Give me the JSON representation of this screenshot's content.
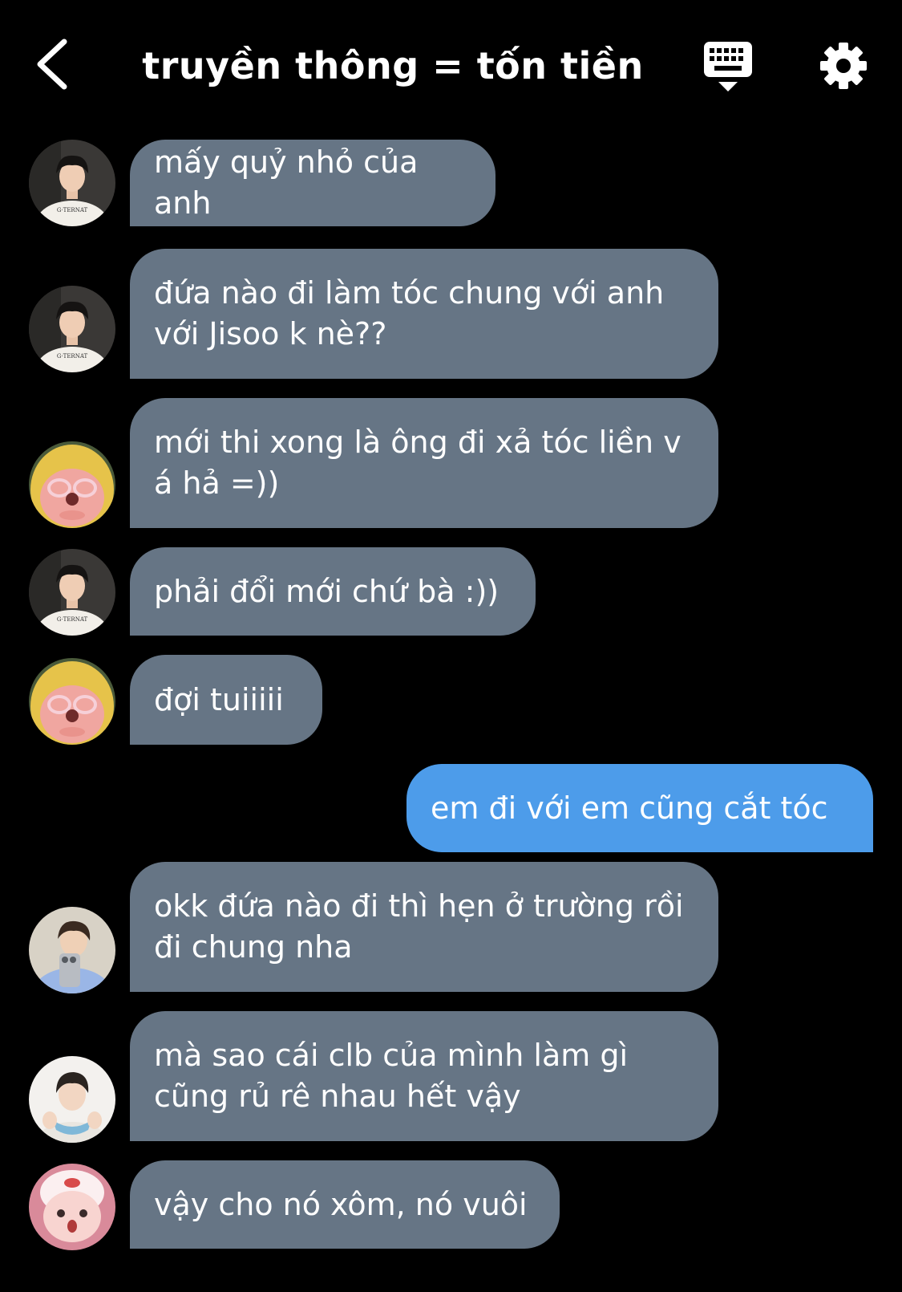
{
  "header": {
    "title": "truyền thông = tốn tiền",
    "back_icon": "chevron-left-icon",
    "keyboard_icon": "keyboard-icon",
    "settings_icon": "gear-icon"
  },
  "colors": {
    "background": "#000000",
    "incoming_bubble": "#667585",
    "outgoing_bubble": "#4d9cea",
    "text": "#ffffff"
  },
  "messages": [
    {
      "text": "mấy quỷ nhỏ của anh",
      "direction": "incoming",
      "avatar": "boy-black-hair-white-shirt"
    },
    {
      "text": "đứa nào đi làm tóc chung với anh với Jisoo k nè??",
      "direction": "incoming",
      "avatar": "boy-black-hair-white-shirt"
    },
    {
      "text": "mới thi xong là ông đi xả tóc liền v á hả =))",
      "direction": "incoming",
      "avatar": "pink-plush-yellow-hat"
    },
    {
      "text": "phải đổi mới chứ bà :))",
      "direction": "incoming",
      "avatar": "boy-black-hair-white-shirt"
    },
    {
      "text": "đợi tuiiiii",
      "direction": "incoming",
      "avatar": "pink-plush-yellow-hat"
    },
    {
      "text": "em đi với em cũng cắt tóc",
      "direction": "outgoing"
    },
    {
      "text": "okk đứa nào đi thì hẹn ở trường rồi đi chung nha",
      "direction": "incoming",
      "avatar": "boy-phone-selfie"
    },
    {
      "text": "mà sao cái clb của mình làm gì cũng rủ rê nhau hết vậy",
      "direction": "incoming",
      "avatar": "boy-blue-scarf"
    },
    {
      "text": "vậy cho nó xôm, nó vuôi",
      "direction": "incoming",
      "avatar": "pink-plush-white-hat"
    }
  ]
}
